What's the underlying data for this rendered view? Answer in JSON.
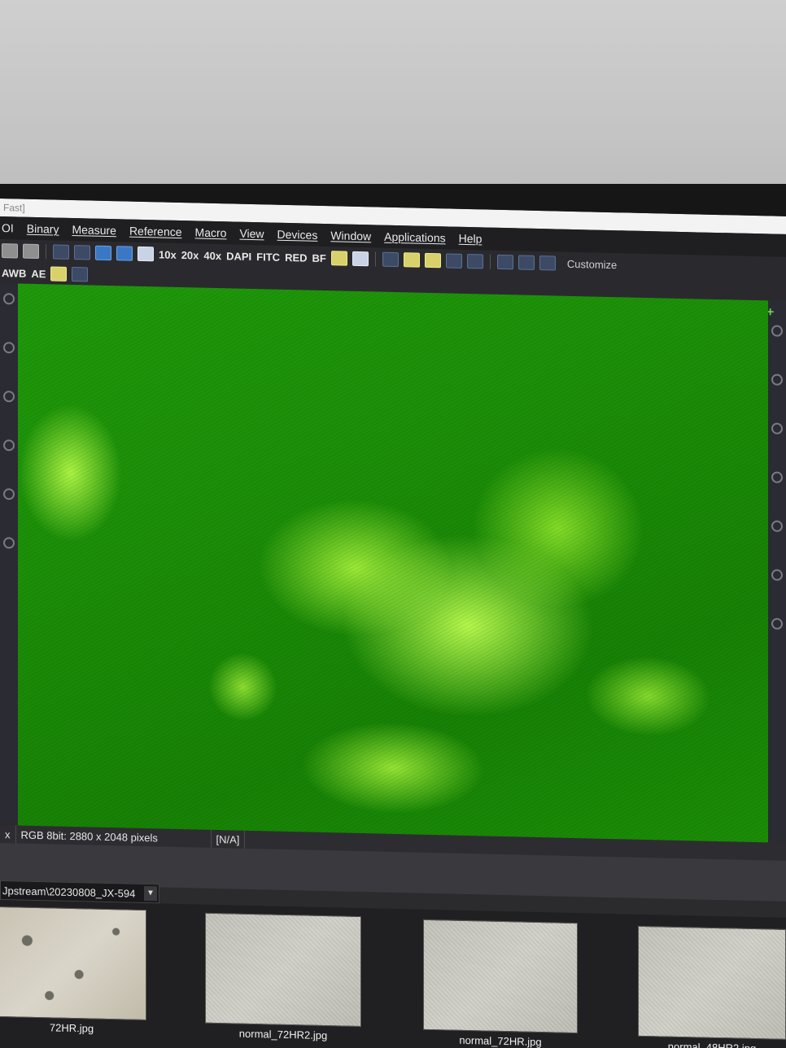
{
  "window": {
    "title": "Fast]"
  },
  "menu": [
    "OI",
    "Binary",
    "Measure",
    "Reference",
    "Macro",
    "View",
    "Devices",
    "Window",
    "Applications",
    "Help"
  ],
  "toolbar": {
    "objectives": [
      "10x",
      "20x",
      "40x"
    ],
    "channels": [
      "DAPI",
      "FITC",
      "RED",
      "BF"
    ],
    "customize_label": "Customize",
    "awb_label": "AWB",
    "ae_label": "AE"
  },
  "status": {
    "zoom_fragment": "x",
    "image_info": "RGB 8bit: 2880 x 2048 pixels",
    "position": "[N/A]"
  },
  "browser": {
    "path": "Jpstream\\20230808_JX-594",
    "thumbnails": [
      "72HR.jpg",
      "normal_72HR2.jpg",
      "normal_72HR.jpg",
      "normal_48HR2.jpg"
    ]
  },
  "icons": [
    "open-icon",
    "camera-icon",
    "circle-tool-icon",
    "sigma-icon",
    "save-icon",
    "add-image-icon",
    "window-icon",
    "highlight-icon",
    "settings-icon",
    "line-tool-icon",
    "layers-icon",
    "stack-icon",
    "wave-icon",
    "stats-icon",
    "histogram-icon",
    "copy-icon",
    "report-icon",
    "plus-icon"
  ],
  "colors": {
    "fluorescence": "#1f9a0a",
    "cell_highlight": "#b6ff4a"
  }
}
